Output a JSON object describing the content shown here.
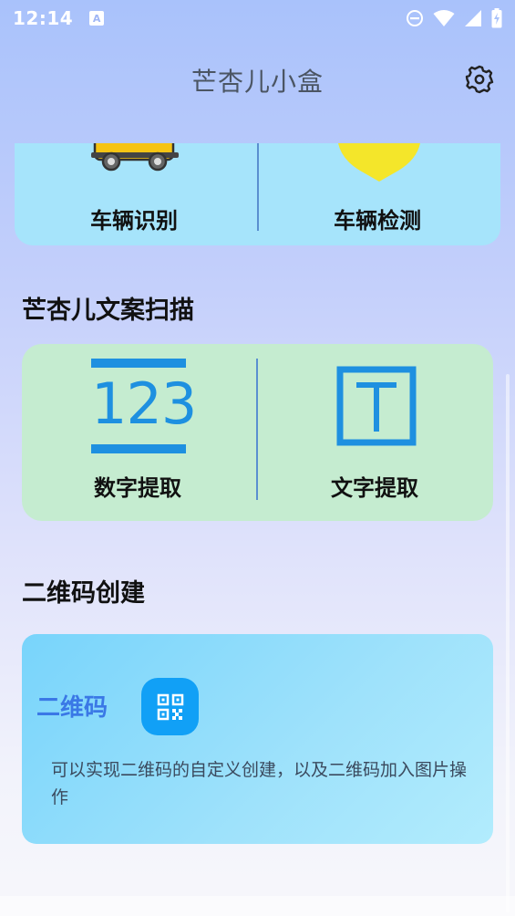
{
  "status_bar": {
    "time": "12:14",
    "notification_badge": "A",
    "icons": [
      "dnd-icon",
      "wifi-icon",
      "signal-icon",
      "battery-charging-icon"
    ]
  },
  "app_bar": {
    "title": "芒杏儿小盒",
    "settings_icon": "gear-icon"
  },
  "vehicle_card": {
    "items": [
      {
        "label": "车辆识别",
        "icon": "car-icon"
      },
      {
        "label": "车辆检测",
        "icon": "heart-icon"
      }
    ]
  },
  "scan_section": {
    "title": "芒杏儿文案扫描",
    "items": [
      {
        "label": "数字提取",
        "icon": "numbers-123-icon",
        "icon_text": "123"
      },
      {
        "label": "文字提取",
        "icon": "text-t-icon"
      }
    ]
  },
  "qr_section": {
    "title": "二维码创建",
    "card_title": "二维码",
    "card_icon": "qr-code-icon",
    "description": "可以实现二维码的自定义创建，以及二维码加入图片操作"
  },
  "colors": {
    "accent_blue": "#1e90e0",
    "qr_button": "#11a0f6",
    "vehicle_card_bg": "#a6e4fb",
    "scan_card_bg": "#c5ecd0",
    "car_yellow": "#f6c414",
    "heart_yellow": "#f4e62a"
  }
}
